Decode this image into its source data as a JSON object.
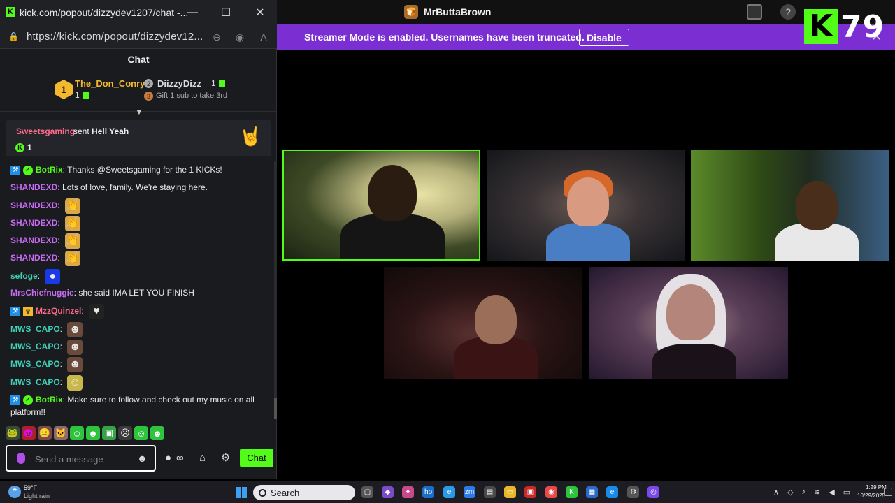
{
  "stream": {
    "channel_name": "MrButtaBrown",
    "kick_logo_letter": "K",
    "kick_count": "79",
    "banner": {
      "text": "Streamer Mode is enabled. Usernames have been truncated.",
      "button_label": "Disable",
      "close_glyph": "✕"
    },
    "accent_color": "#53fc18",
    "banner_color": "#7b2fd2"
  },
  "popout": {
    "window_title": "kick.com/popout/dizzydev1207/chat -...",
    "url": "https://kick.com/popout/dizzydev12...",
    "chat_header": "Chat",
    "leaderboard": {
      "first": {
        "rank": "1",
        "name": "The_Don_Conry",
        "count": "1"
      },
      "second": {
        "rank": "2",
        "name": "DiizzyDizz",
        "count": "1"
      },
      "third": {
        "rank": "3",
        "text": "Gift 1 sub to take 3rd"
      }
    },
    "pinned": {
      "user": "Sweetsgaming",
      "action": "sent",
      "item": "Hell Yeah",
      "kicks": "1"
    },
    "messages": [
      {
        "user": "BotRix",
        "color": "#53fc18",
        "text": "Thanks @Sweetsgaming for the 1 KICKs!",
        "badges": [
          "bot",
          "verified"
        ]
      },
      {
        "user": "SHANDEXD",
        "color": "#c76bf2",
        "text": "Lots of love, family. We're staying here."
      },
      {
        "user": "SHANDEXD",
        "color": "#c76bf2",
        "text": "",
        "emote": "clap-emote"
      },
      {
        "user": "SHANDEXD",
        "color": "#c76bf2",
        "text": "",
        "emote": "clap-emote"
      },
      {
        "user": "SHANDEXD",
        "color": "#c76bf2",
        "text": "",
        "emote": "clap-emote"
      },
      {
        "user": "SHANDEXD",
        "color": "#c76bf2",
        "text": "",
        "emote": "clap-emote"
      },
      {
        "user": "sefoge",
        "color": "#3fd0b8",
        "text": "",
        "emote": "blue-orb-emote"
      },
      {
        "user": "MrsChiefnuggie",
        "color": "#c76bf2",
        "text": "she said IMA LET YOU FINISH"
      },
      {
        "user": "MzzQuinzel",
        "color": "#ff6b8a",
        "text": "",
        "emote": "heart-emote",
        "badges": [
          "bot",
          "crown"
        ]
      },
      {
        "user": "MWS_CAPO",
        "color": "#3fd0b8",
        "text": "",
        "emote": "face-emote"
      },
      {
        "user": "MWS_CAPO",
        "color": "#3fd0b8",
        "text": "",
        "emote": "face-emote"
      },
      {
        "user": "MWS_CAPO",
        "color": "#3fd0b8",
        "text": "",
        "emote": "face-emote"
      },
      {
        "user": "MWS_CAPO",
        "color": "#3fd0b8",
        "text": "",
        "emote": "cat-emote"
      },
      {
        "user": "BotRix",
        "color": "#53fc18",
        "text": "Make sure to follow and check out my music on all platform!!",
        "badges": [
          "bot",
          "verified"
        ]
      }
    ],
    "input_placeholder": "Send a message",
    "chat_button": "Chat"
  },
  "taskbar": {
    "weather_temp": "59°F",
    "weather_cond": "Light rain",
    "search_label": "Search",
    "time": "1:29 PM",
    "date": "10/29/2025"
  }
}
